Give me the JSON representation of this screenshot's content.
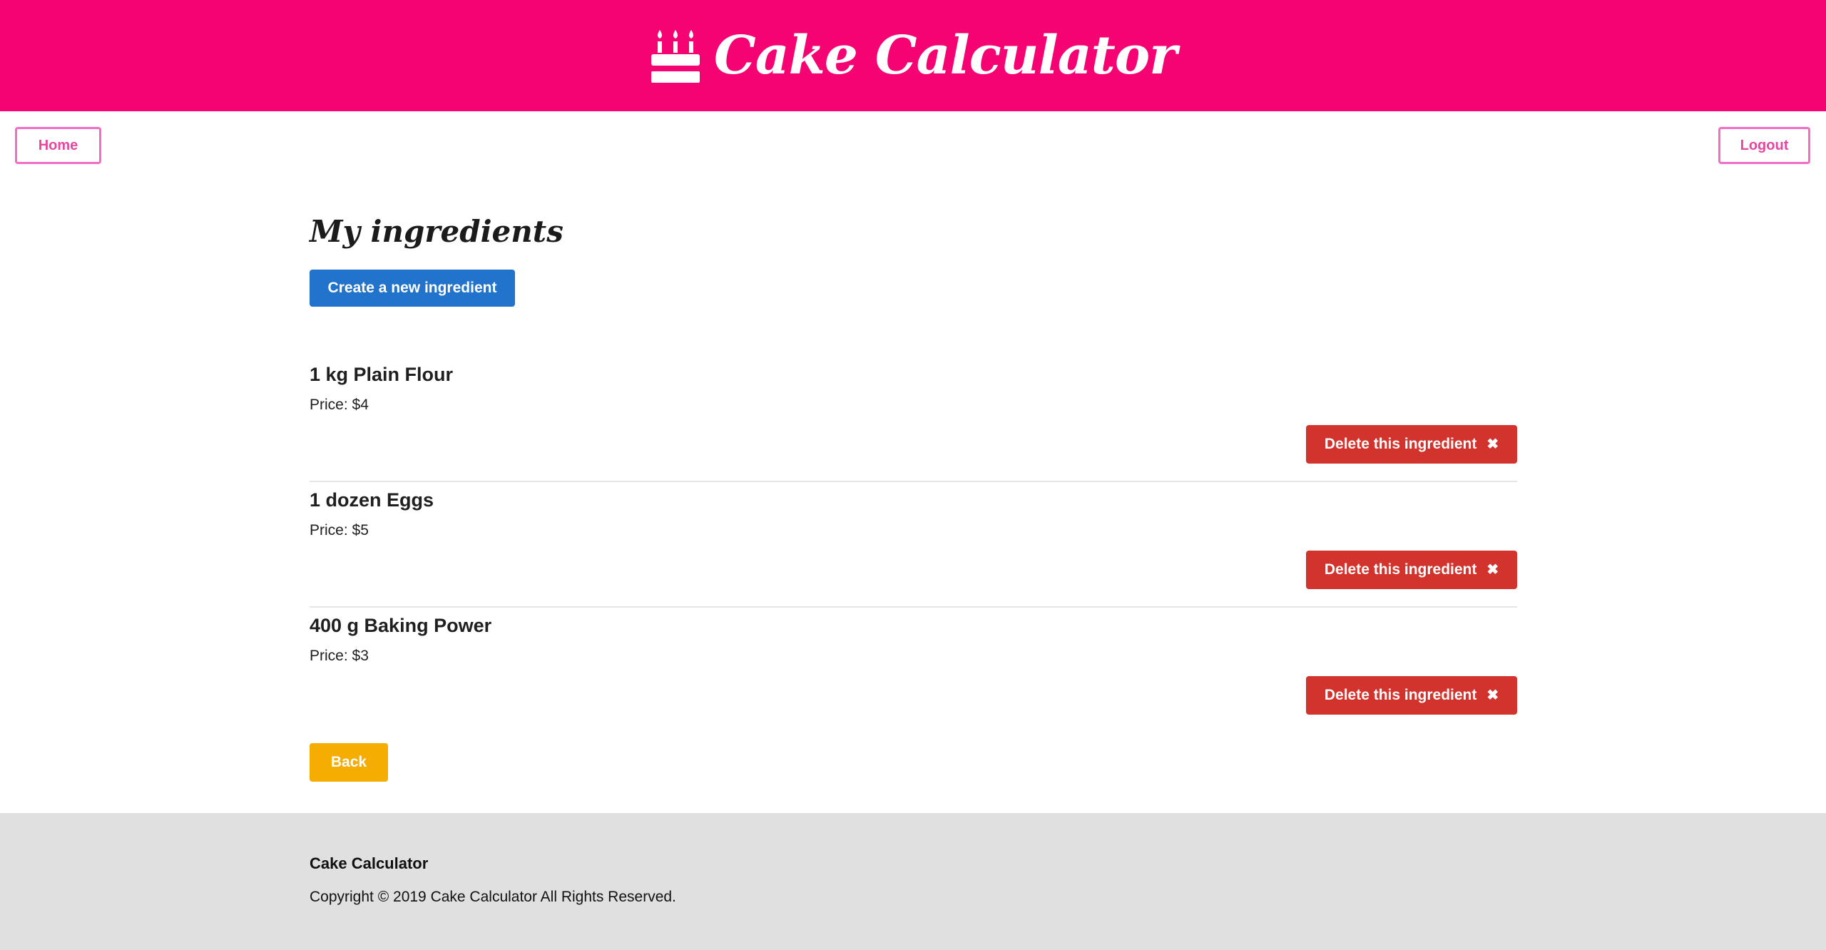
{
  "header": {
    "title": "Cake Calculator",
    "icon": "birthday-cake-icon",
    "background_color": "#f50372"
  },
  "nav": {
    "home_label": "Home",
    "logout_label": "Logout",
    "accent_color": "#f26dc4"
  },
  "main": {
    "title": "My ingredients",
    "create_button_label": "Create a new ingredient",
    "back_button_label": "Back",
    "ingredients": [
      {
        "name": "1 kg Plain Flour",
        "price": "Price: $4",
        "delete_label": "Delete this ingredient"
      },
      {
        "name": "1 dozen Eggs",
        "price": "Price: $5",
        "delete_label": "Delete this ingredient"
      },
      {
        "name": "400 g Baking Power",
        "price": "Price: $3",
        "delete_label": "Delete this ingredient"
      }
    ],
    "colors": {
      "create": "#2273cc",
      "delete": "#d2332c",
      "back": "#f4ad00"
    }
  },
  "footer": {
    "title": "Cake Calculator",
    "copyright": "Copyright © 2019 Cake Calculator All Rights Reserved."
  }
}
